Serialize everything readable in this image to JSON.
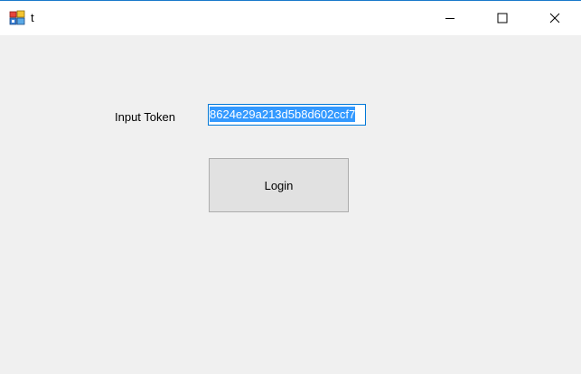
{
  "window": {
    "title": "t"
  },
  "form": {
    "token_label": "Input Token",
    "token_value": "8624e29a213d5b8d602ccf7",
    "login_label": "Login"
  },
  "colors": {
    "selection": "#3399ff",
    "focus_border": "#0078d7",
    "button_face": "#e1e1e1",
    "window_bg": "#f0f0f0"
  }
}
